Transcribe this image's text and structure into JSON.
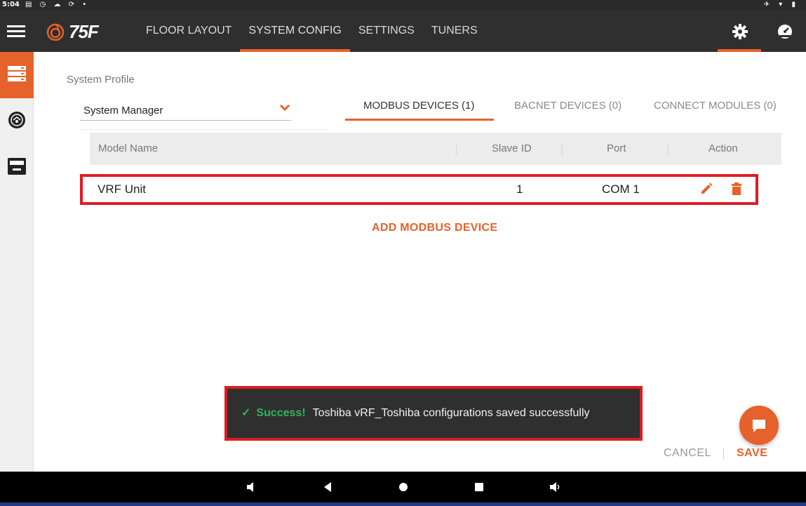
{
  "status_bar": {
    "time": "5:04",
    "left_icons": "▤ ◷ ☁ ⟳ •",
    "right_icons": "✈ ▾ ▮"
  },
  "app": {
    "brand": "75F",
    "nav": [
      {
        "label": "FLOOR LAYOUT",
        "active": false
      },
      {
        "label": "SYSTEM CONFIG",
        "active": true
      },
      {
        "label": "SETTINGS",
        "active": false
      },
      {
        "label": "TUNERS",
        "active": false
      }
    ],
    "accent_color": "#e5622a"
  },
  "profile": {
    "label": "System Profile",
    "selected": "System Manager"
  },
  "tabs": [
    {
      "label": "MODBUS DEVICES (1)",
      "active": true
    },
    {
      "label": "BACNET DEVICES (0)",
      "active": false
    },
    {
      "label": "CONNECT MODULES (0)",
      "active": false
    }
  ],
  "table": {
    "columns": [
      "Model Name",
      "Slave ID",
      "Port",
      "Action"
    ],
    "rows": [
      {
        "model_name": "VRF Unit",
        "slave_id": "1",
        "port": "COM 1"
      }
    ]
  },
  "add_device_label": "ADD MODBUS DEVICE",
  "toast": {
    "status": "Success!",
    "message": "Toshiba vRF_Toshiba configurations saved successfully"
  },
  "footer": {
    "cancel": "CANCEL",
    "save": "SAVE"
  }
}
